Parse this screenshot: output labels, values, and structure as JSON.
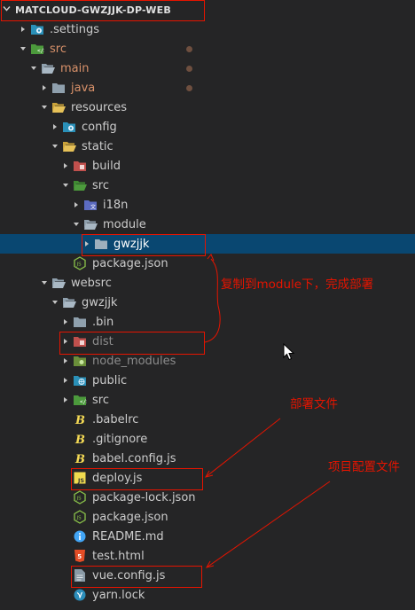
{
  "explorer": {
    "project_title": "MATCLOUD-GWZJJK-DP-WEB",
    "items": [
      {
        "label": ".settings",
        "icon": "settings-folder-icon"
      },
      {
        "label": "src",
        "icon": "src-folder-icon"
      },
      {
        "label": "main",
        "icon": "folder-icon"
      },
      {
        "label": "java",
        "icon": "folder-icon"
      },
      {
        "label": "resources",
        "icon": "folder-open-icon"
      },
      {
        "label": "config",
        "icon": "config-folder-icon"
      },
      {
        "label": "static",
        "icon": "folder-open-icon"
      },
      {
        "label": "build",
        "icon": "build-folder-icon"
      },
      {
        "label": "src",
        "icon": "src-folder-icon"
      },
      {
        "label": "i18n",
        "icon": "i18n-folder-icon"
      },
      {
        "label": "module",
        "icon": "folder-open-icon"
      },
      {
        "label": "gwzjjk",
        "icon": "folder-icon"
      },
      {
        "label": "package.json",
        "icon": "nodejs-file-icon"
      },
      {
        "label": "websrc",
        "icon": "folder-open-icon"
      },
      {
        "label": "gwzjjk",
        "icon": "folder-open-icon"
      },
      {
        "label": ".bin",
        "icon": "folder-icon"
      },
      {
        "label": "dist",
        "icon": "dist-folder-icon"
      },
      {
        "label": "node_modules",
        "icon": "node-modules-folder-icon"
      },
      {
        "label": "public",
        "icon": "public-folder-icon"
      },
      {
        "label": "src",
        "icon": "src-folder-icon"
      },
      {
        "label": ".babelrc",
        "icon": "babel-file-icon"
      },
      {
        "label": ".gitignore",
        "icon": "babel-file-icon"
      },
      {
        "label": "babel.config.js",
        "icon": "babel-file-icon"
      },
      {
        "label": "deploy.js",
        "icon": "js-file-icon"
      },
      {
        "label": "package-lock.json",
        "icon": "nodejs-file-icon"
      },
      {
        "label": "package.json",
        "icon": "nodejs-file-icon"
      },
      {
        "label": "README.md",
        "icon": "info-file-icon"
      },
      {
        "label": "test.html",
        "icon": "html-file-icon"
      },
      {
        "label": "vue.config.js",
        "icon": "config-file-icon"
      },
      {
        "label": "yarn.lock",
        "icon": "yarn-file-icon"
      }
    ]
  },
  "annotations": {
    "copy_note": "复制到module下，完成部署",
    "deploy_note": "部署文件",
    "config_note": "项目配置文件"
  },
  "colors": {
    "sidebar_bg": "#252526",
    "selected_bg": "#094771",
    "annotation_red": "#e51400",
    "git_modified": "#e2c08d"
  }
}
